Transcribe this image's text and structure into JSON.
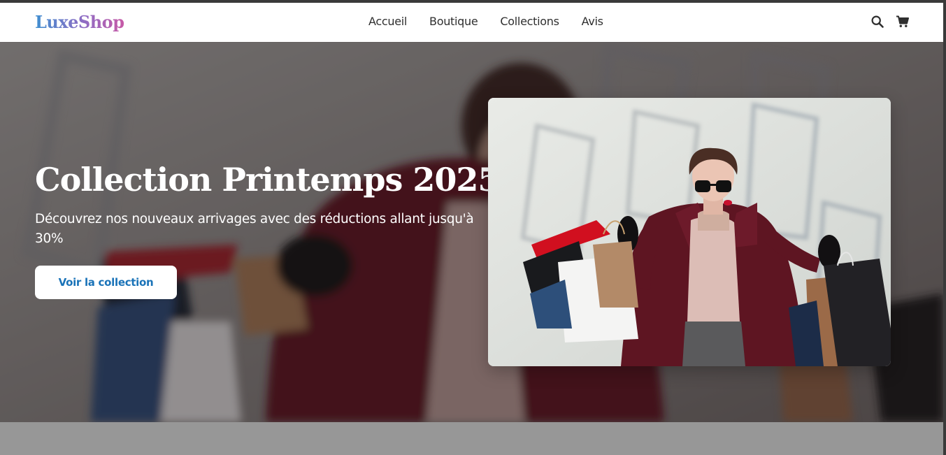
{
  "brand": {
    "name": "LuxeShop"
  },
  "nav": {
    "links": [
      "Accueil",
      "Boutique",
      "Collections",
      "Avis"
    ],
    "icons": [
      "search-icon",
      "cart-icon"
    ]
  },
  "hero": {
    "title": "Collection Printemps 2025",
    "subtitle": "Découvrez nos nouveaux arrivages avec des réductions allant jusqu'à 30%",
    "cta_label": "Voir la collection"
  },
  "colors": {
    "brand_gradient": [
      "#3f8fd0",
      "#c65aa7"
    ],
    "cta_text": "#1a73b8",
    "coat": "#5e1522",
    "lips": "#c8102e"
  }
}
